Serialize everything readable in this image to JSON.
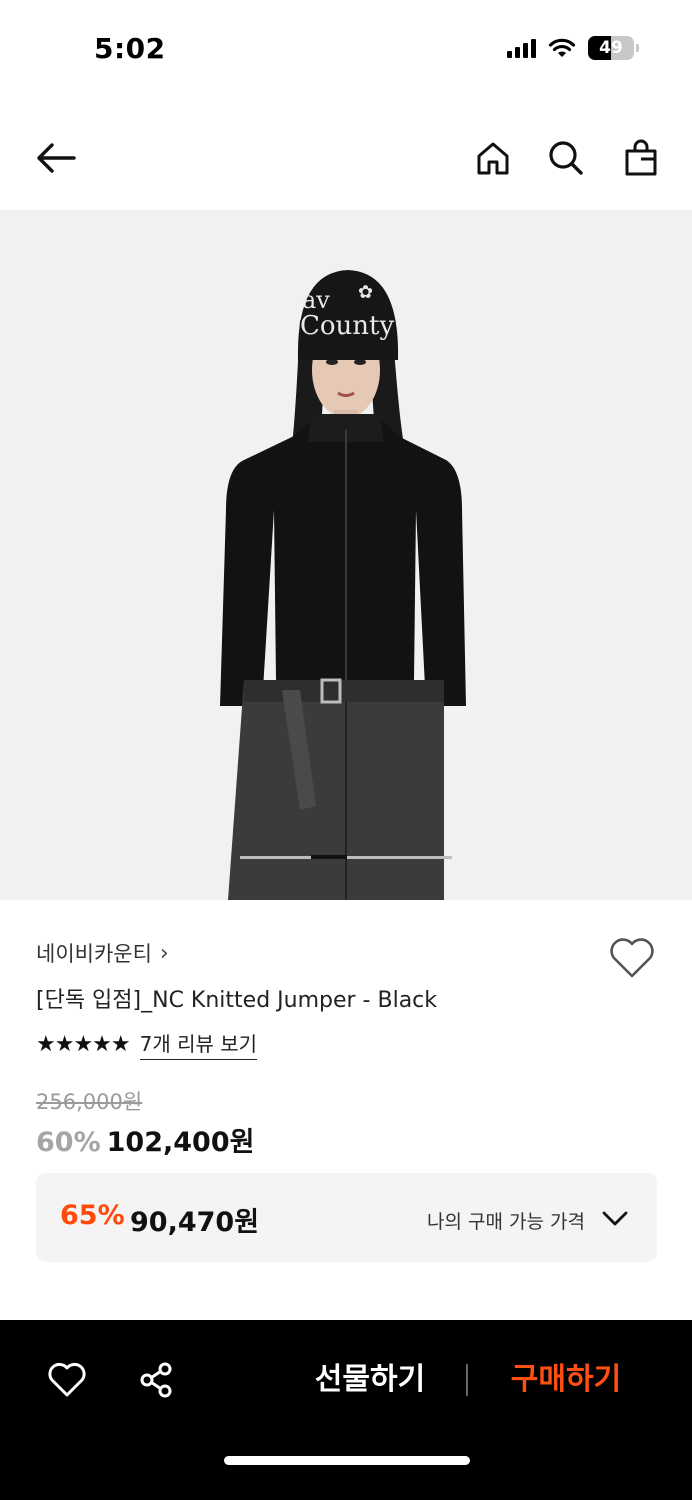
{
  "status_bar": {
    "time": "5:02",
    "battery": "49"
  },
  "icons": {
    "back": "arrow-left-icon",
    "home": "home-icon",
    "search": "search-icon",
    "bag": "shopping-bag-icon",
    "wish": "heart-icon",
    "share": "share-icon",
    "brand_chevron": "chevron-right-icon",
    "price_chevron": "chevron-down-icon"
  },
  "product": {
    "brand": "네이비카운티",
    "brand_chevron": "›",
    "name": "[단독 입점]_NC Knitted Jumper - Black",
    "rating_stars": 5,
    "stars_glyph": "★★★★★",
    "review_link": "7개 리뷰 보기",
    "original_price": "256,000원",
    "discount_percent": "60%",
    "sale_price": "102,400원",
    "slide_position": 0.4
  },
  "my_price": {
    "percent": "65%",
    "price": "90,470원",
    "label": "나의 구매 가능 가격"
  },
  "bottom_bar": {
    "gift_label": "선물하기",
    "buy_label": "구매하기"
  },
  "colors": {
    "accent": "#ff4a0a",
    "bottom_bar_bg": "#000000",
    "image_bg": "#f1f1f1"
  }
}
